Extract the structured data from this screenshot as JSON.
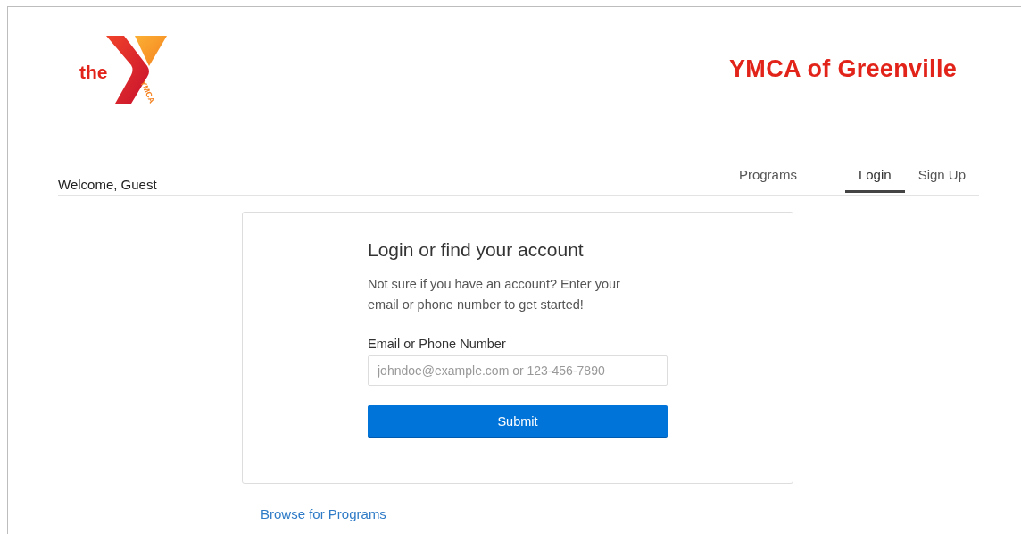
{
  "header": {
    "logo_word": "the",
    "logo_mark": "YMCA",
    "title": "YMCA of Greenville"
  },
  "welcome": "Welcome, Guest",
  "nav": [
    {
      "label": "Programs",
      "selected": false
    },
    {
      "label": "Login",
      "selected": true
    },
    {
      "label": "Sign Up",
      "selected": false
    }
  ],
  "login_card": {
    "heading": "Login or find your account",
    "intro": "Not sure if you have an account? Enter your email or phone number to get started!",
    "field_label": "Email or Phone Number",
    "placeholder": "johndoe@example.com or 123-456-7890",
    "button": "Submit"
  },
  "footer_link": "Browse for Programs"
}
